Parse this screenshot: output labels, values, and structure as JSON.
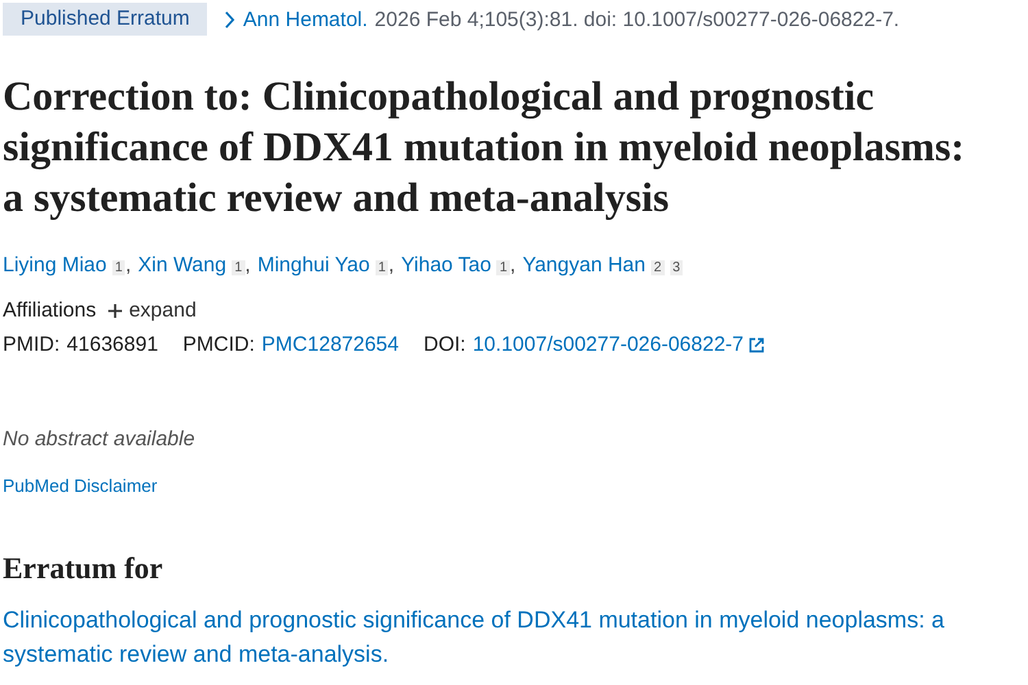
{
  "badge": "Published Erratum",
  "citation": {
    "journal": "Ann Hematol.",
    "details": "2026 Feb 4;105(3):81. doi: 10.1007/s00277-026-06822-7."
  },
  "author_separator": ",",
  "title": "Correction to: Clinicopathological and prognostic significance of DDX41 mutation in myeloid neoplasms: a systematic review and meta-analysis",
  "authors": [
    {
      "name": "Liying Miao",
      "refs": [
        "1"
      ]
    },
    {
      "name": "Xin Wang",
      "refs": [
        "1"
      ]
    },
    {
      "name": "Minghui Yao",
      "refs": [
        "1"
      ]
    },
    {
      "name": "Yihao Tao",
      "refs": [
        "1"
      ]
    },
    {
      "name": "Yangyan Han",
      "refs": [
        "2",
        "3"
      ]
    }
  ],
  "affiliations": {
    "label": "Affiliations",
    "toggle": "expand",
    "expanded": false
  },
  "ids": {
    "pmid_label": "PMID:",
    "pmid": "41636891",
    "pmcid_label": "PMCID:",
    "pmcid": "PMC12872654",
    "doi_label": "DOI:",
    "doi": "10.1007/s00277-026-06822-7"
  },
  "abstract_note": "No abstract available",
  "disclaimer": "PubMed Disclaimer",
  "erratum": {
    "heading": "Erratum for",
    "link": "Clinicopathological and prognostic significance of DDX41 mutation in myeloid neoplasms: a systematic review and meta-analysis."
  }
}
